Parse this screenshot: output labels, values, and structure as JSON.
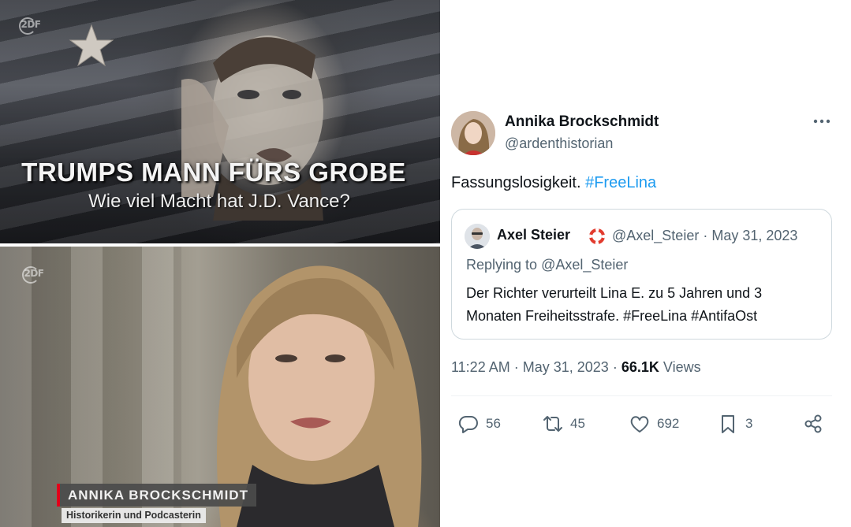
{
  "tv_top": {
    "logo": "2DF",
    "headline": "TRUMPS MANN FÜRS GROBE",
    "subheadline": "Wie viel Macht hat J.D. Vance?"
  },
  "tv_bottom": {
    "logo": "2DF",
    "name": "ANNIKA BROCKSCHMIDT",
    "role": "Historikerin und Podcasterin"
  },
  "tweet": {
    "author": {
      "display_name": "Annika Brockschmidt",
      "handle": "@ardenthistorian"
    },
    "text": "Fassungslosigkeit.",
    "hashtag": "#FreeLina",
    "quoted": {
      "display_name": "Axel Steier",
      "handle": "@Axel_Steier",
      "date": "May 31, 2023",
      "meta_separator": "·",
      "replying_to_prefix": "Replying to",
      "replying_to": "@Axel_Steier",
      "text_line1": "Der Richter verurteilt Lina E. zu 5 Jahren und 3",
      "text_line2": "Monaten Freiheitsstrafe. #FreeLina #AntifaOst"
    },
    "time": "11:22 AM",
    "date": "May 31, 2023",
    "views_count": "66.1K",
    "views_label": "Views",
    "actions": {
      "replies": "56",
      "retweets": "45",
      "likes": "692",
      "bookmarks": "3"
    },
    "colors": {
      "link": "#1d9bf0",
      "secondary": "#536471",
      "text": "#0f1419"
    },
    "icons": [
      "more-icon",
      "reply-icon",
      "retweet-icon",
      "like-icon",
      "bookmark-icon",
      "share-icon",
      "lifebuoy-badge-icon"
    ]
  }
}
